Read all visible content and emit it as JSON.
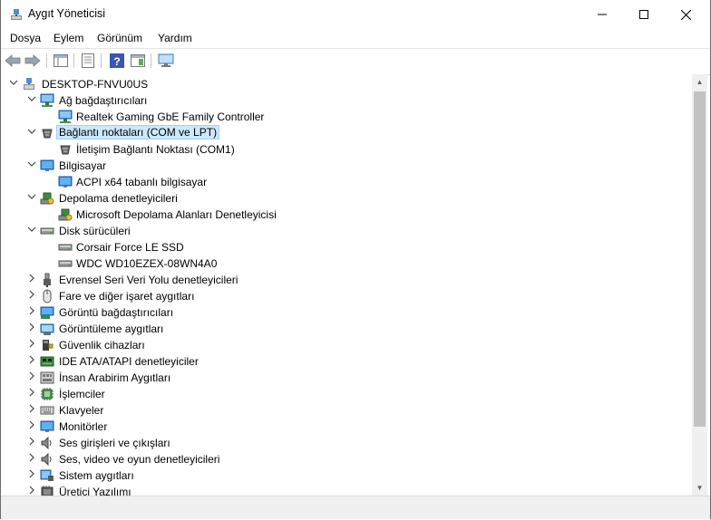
{
  "window": {
    "title": "Aygıt Yöneticisi"
  },
  "menu": [
    "Dosya",
    "Eylem",
    "Görünüm",
    "Yardım"
  ],
  "tree": [
    {
      "level": 0,
      "expander": "expanded",
      "icon": "computer-root-icon",
      "label": "DESKTOP-FNVU0US"
    },
    {
      "level": 1,
      "expander": "expanded",
      "icon": "network-adapter-icon",
      "label": "Ağ bağdaştırıcıları"
    },
    {
      "level": 2,
      "expander": "none",
      "icon": "network-adapter-icon",
      "label": "Realtek Gaming GbE Family Controller"
    },
    {
      "level": 1,
      "expander": "expanded",
      "icon": "port-icon",
      "label": "Bağlantı noktaları (COM ve LPT)",
      "selected": true
    },
    {
      "level": 2,
      "expander": "none",
      "icon": "port-icon",
      "label": "İletişim Bağlantı Noktası (COM1)"
    },
    {
      "level": 1,
      "expander": "expanded",
      "icon": "monitor-icon",
      "label": "Bilgisayar"
    },
    {
      "level": 2,
      "expander": "none",
      "icon": "monitor-icon",
      "label": "ACPI x64 tabanlı bilgisayar"
    },
    {
      "level": 1,
      "expander": "expanded",
      "icon": "storage-controller-icon",
      "label": "Depolama denetleyicileri"
    },
    {
      "level": 2,
      "expander": "none",
      "icon": "storage-controller-icon",
      "label": "Microsoft Depolama Alanları Denetleyicisi"
    },
    {
      "level": 1,
      "expander": "expanded",
      "icon": "disk-drive-icon",
      "label": "Disk sürücüleri"
    },
    {
      "level": 2,
      "expander": "none",
      "icon": "disk-drive-icon",
      "label": "Corsair Force LE SSD"
    },
    {
      "level": 2,
      "expander": "none",
      "icon": "disk-drive-icon",
      "label": "WDC WD10EZEX-08WN4A0"
    },
    {
      "level": 1,
      "expander": "collapsed",
      "icon": "usb-icon",
      "label": "Evrensel Seri Veri Yolu denetleyicileri"
    },
    {
      "level": 1,
      "expander": "collapsed",
      "icon": "mouse-icon",
      "label": "Fare ve diğer işaret aygıtları"
    },
    {
      "level": 1,
      "expander": "collapsed",
      "icon": "display-adapter-icon",
      "label": "Görüntü bağdaştırıcıları"
    },
    {
      "level": 1,
      "expander": "collapsed",
      "icon": "imaging-device-icon",
      "label": "Görüntüleme aygıtları"
    },
    {
      "level": 1,
      "expander": "collapsed",
      "icon": "security-device-icon",
      "label": "Güvenlik cihazları"
    },
    {
      "level": 1,
      "expander": "collapsed",
      "icon": "ide-controller-icon",
      "label": "IDE ATA/ATAPI denetleyiciler"
    },
    {
      "level": 1,
      "expander": "collapsed",
      "icon": "hid-icon",
      "label": "İnsan Arabirim Aygıtları"
    },
    {
      "level": 1,
      "expander": "collapsed",
      "icon": "processor-icon",
      "label": "İşlemciler"
    },
    {
      "level": 1,
      "expander": "collapsed",
      "icon": "keyboard-icon",
      "label": "Klavyeler"
    },
    {
      "level": 1,
      "expander": "collapsed",
      "icon": "monitor-icon",
      "label": "Monitörler"
    },
    {
      "level": 1,
      "expander": "collapsed",
      "icon": "audio-icon",
      "label": "Ses girişleri ve çıkışları"
    },
    {
      "level": 1,
      "expander": "collapsed",
      "icon": "audio-icon",
      "label": "Ses, video ve oyun denetleyicileri"
    },
    {
      "level": 1,
      "expander": "collapsed",
      "icon": "system-device-icon",
      "label": "Sistem aygıtları"
    },
    {
      "level": 1,
      "expander": "collapsed",
      "icon": "firmware-icon",
      "label": "Üretici Yazılımı"
    }
  ],
  "colors": {
    "selection_bg": "#cce8ff",
    "selection_border": "#99d1ff",
    "icon_blue": "#2b7bd8"
  }
}
